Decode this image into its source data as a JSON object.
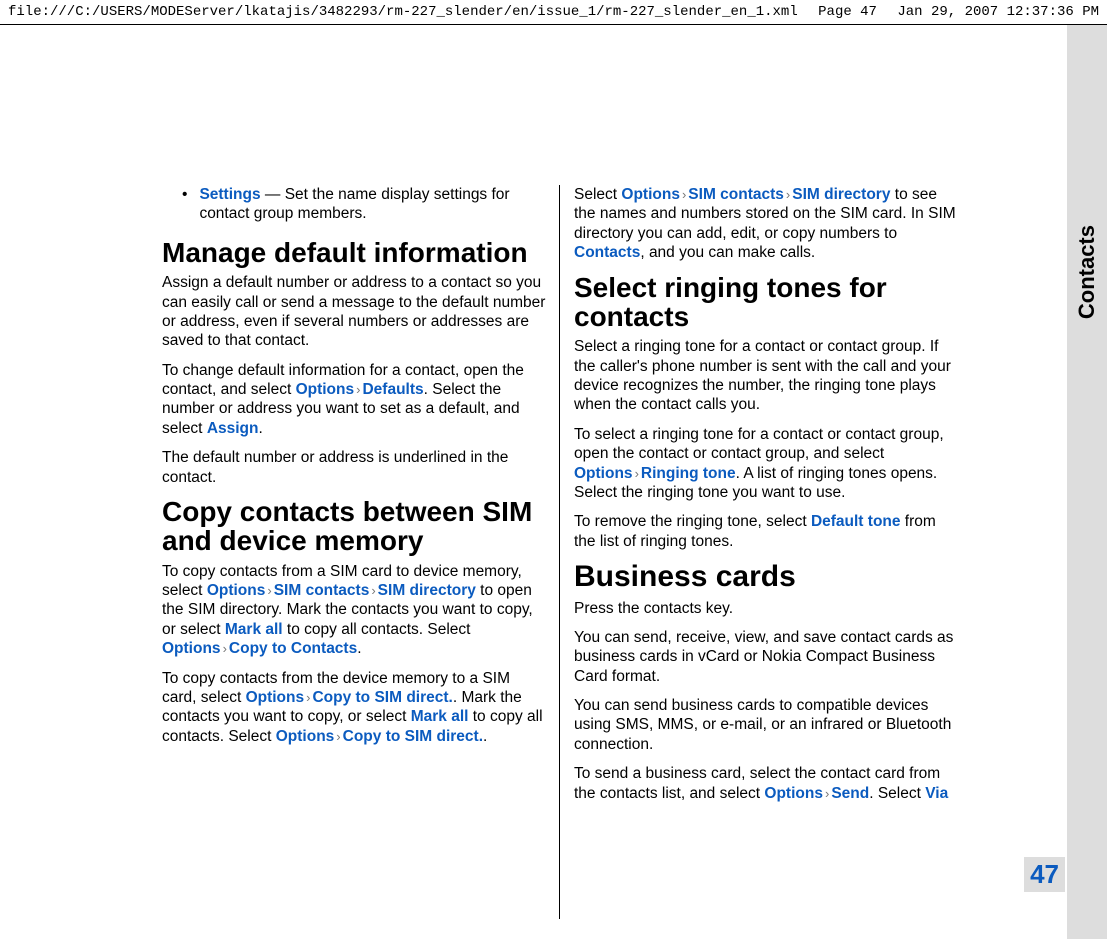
{
  "header": {
    "path": "file:///C:/USERS/MODEServer/lkatajis/3482293/rm-227_slender/en/issue_1/rm-227_slender_en_1.xml",
    "page": "Page 47",
    "timestamp": "Jan 29, 2007 12:37:36 PM"
  },
  "side_tab": "Contacts",
  "page_number": "47",
  "left": {
    "bullet": {
      "term": "Settings",
      "desc": " — Set the name display settings for contact group members."
    },
    "h1": "Manage default information",
    "p1": "Assign a default number or address to a contact so you can easily call or send a message to the default number or address, even if several numbers or addresses are saved to that contact.",
    "p2a": "To change default information for a contact, open the contact, and select ",
    "p2_opt": "Options",
    "p2_def": "Defaults",
    "p2b": ". Select the number or address you want to set as a default, and select ",
    "p2_assign": "Assign",
    "p2c": ".",
    "p3": "The default number or address is underlined in the contact.",
    "h2": "Copy contacts between SIM and device memory",
    "p4a": "To copy contacts from a SIM card to device memory, select ",
    "p4_opt": "Options",
    "p4_sim": "SIM contacts",
    "p4_dir": "SIM directory",
    "p4b": " to open the SIM directory. Mark the contacts you want to copy, or select ",
    "p4_markall": "Mark all",
    "p4c": " to copy all contacts. Select ",
    "p4_opt2": "Options",
    "p4_copy": "Copy to Contacts",
    "p4d": ".",
    "p5a": "To copy contacts from the device memory to a SIM card, select ",
    "p5_opt": "Options",
    "p5_copy": "Copy to SIM direct.",
    "p5b": ". Mark the contacts you want to copy, or select ",
    "p5_markall": "Mark all",
    "p5c": " to copy all contacts. Select ",
    "p5_opt2": "Options",
    "p5_copy2": "Copy to SIM direct.",
    "p5d": "."
  },
  "right": {
    "p0a": "Select ",
    "p0_opt": "Options",
    "p0_sim": "SIM contacts",
    "p0_dir": "SIM directory",
    "p0b": " to see the names and numbers stored on the SIM card. In SIM directory you can add, edit, or copy numbers to ",
    "p0_contacts": "Contacts",
    "p0c": ", and you can make calls.",
    "h1": "Select ringing tones for contacts",
    "p1": "Select a ringing tone for a contact or contact group. If the caller's phone number is sent with the call and your device recognizes the number, the ringing tone plays when the contact calls you.",
    "p2a": "To select a ringing tone for a contact or contact group, open the contact or contact group, and select ",
    "p2_opt": "Options",
    "p2_ring": "Ringing tone",
    "p2b": ". A list of ringing tones opens. Select the ringing tone you want to use.",
    "p3a": "To remove the ringing tone, select ",
    "p3_def": "Default tone",
    "p3b": " from the list of ringing tones.",
    "h2": "Business cards",
    "p4": "Press the contacts key.",
    "p5": "You can send, receive, view, and save contact cards as business cards in vCard or Nokia Compact Business Card format.",
    "p6": "You can send business cards to compatible devices using SMS, MMS, or e-mail, or an infrared or Bluetooth connection.",
    "p7a": "To send a business card, select the contact card from the contacts list, and select ",
    "p7_opt": "Options",
    "p7_send": "Send",
    "p7b": ". Select ",
    "p7_via": "Via"
  }
}
